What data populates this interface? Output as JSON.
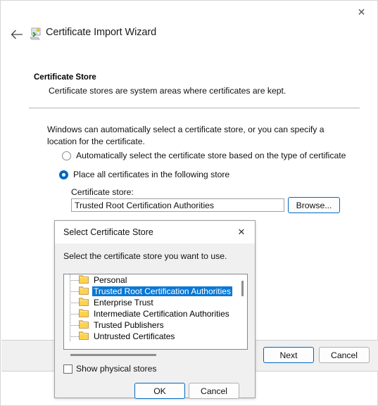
{
  "window": {
    "title": "Certificate Import Wizard",
    "icon": "certificate-icon",
    "close_label": "✕",
    "back_label": "←"
  },
  "page": {
    "heading": "Certificate Store",
    "subheading": "Certificate stores are system areas where certificates are kept.",
    "intro": "Windows can automatically select a certificate store, or you can specify a location for the certificate."
  },
  "options": {
    "auto_label": "Automatically select the certificate store based on the type of certificate",
    "auto_selected": false,
    "place_label": "Place all certificates in the following store",
    "place_selected": true
  },
  "cert_store": {
    "label": "Certificate store:",
    "value": "Trusted Root Certification Authorities",
    "placeholder": "",
    "browse_label": "Browse..."
  },
  "footer": {
    "next_label": "Next",
    "cancel_label": "Cancel"
  },
  "dialog": {
    "title": "Select Certificate Store",
    "close_label": "✕",
    "prompt": "Select the certificate store you want to use.",
    "items": [
      {
        "label": "Personal",
        "selected": false
      },
      {
        "label": "Trusted Root Certification Authorities",
        "selected": true
      },
      {
        "label": "Enterprise Trust",
        "selected": false
      },
      {
        "label": "Intermediate Certification Authorities",
        "selected": false
      },
      {
        "label": "Trusted Publishers",
        "selected": false
      },
      {
        "label": "Untrusted Certificates",
        "selected": false
      }
    ],
    "show_physical_label": "Show physical stores",
    "show_physical_checked": false,
    "ok_label": "OK",
    "cancel_label": "Cancel"
  },
  "colors": {
    "accent": "#0067c0",
    "selection": "#0a78d4",
    "folder": "#ffd24d",
    "panel": "#f0f0f0"
  }
}
